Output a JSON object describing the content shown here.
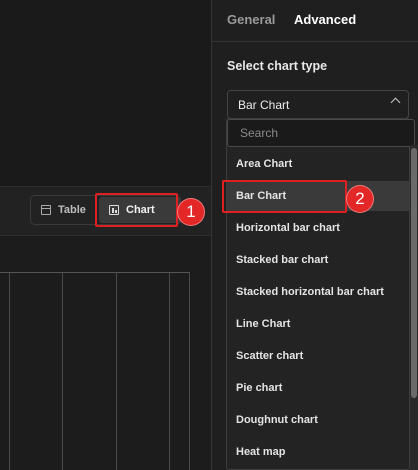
{
  "tabs": {
    "general": "General",
    "advanced": "Advanced"
  },
  "chart_type": {
    "label": "Select chart type",
    "selected": "Bar Chart",
    "search_placeholder": "Search",
    "options": [
      "Area Chart",
      "Bar Chart",
      "Horizontal bar chart",
      "Stacked bar chart",
      "Stacked horizontal bar chart",
      "Line Chart",
      "Scatter chart",
      "Pie chart",
      "Doughnut chart",
      "Heat map"
    ]
  },
  "view_toggle": {
    "table": "Table",
    "chart": "Chart"
  },
  "annotations": {
    "badge1": "1",
    "badge2": "2"
  },
  "colors": {
    "highlight": "#e02020",
    "badge": "#e32626",
    "panel_bg": "#1f1f1f"
  },
  "icons": {
    "table": "table-icon",
    "chart": "chart-icon",
    "select": "chevron-down-icon"
  }
}
